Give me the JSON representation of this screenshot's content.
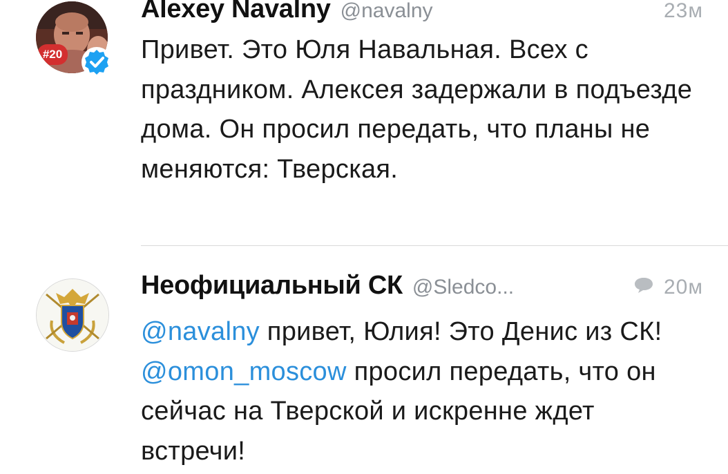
{
  "tweets": [
    {
      "name": "Alexey Navalny",
      "handle": "@navalny",
      "time": "23м",
      "avatar_badge": "#20",
      "verified_icon": "verified-badge",
      "text": "Привет. Это Юля Навальная. Всех с праздником. Алексея задержали в подъезде дома. Он просил передать, что планы не меняются: Тверская."
    },
    {
      "name": "Неофициальный СК",
      "handle": "@Sledco...",
      "time": "20м",
      "reply_icon": "reply-bubble",
      "parts": [
        {
          "text": "@navalny",
          "type": "mention"
        },
        {
          "text": " привет, Юлия! Это Денис из СК! ",
          "type": "text"
        },
        {
          "text": "@omon_moscow",
          "type": "mention"
        },
        {
          "text": " просил передать, что он сейчас на Тверской и искренне ждет встречи!",
          "type": "text"
        }
      ]
    }
  ],
  "colors": {
    "mention": "#2b8fdb",
    "verified": "#1da1f2",
    "badge": "#d32f2f",
    "secondary": "#8a8f95"
  }
}
